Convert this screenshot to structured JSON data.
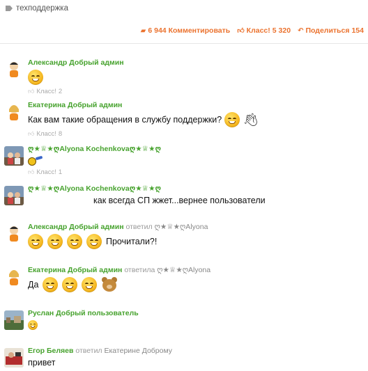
{
  "tag": {
    "label": "техподдержка"
  },
  "actions": {
    "comments": {
      "count": "6 944",
      "label": "Комментировать"
    },
    "klass": {
      "label": "Класс!",
      "count": "5 320"
    },
    "share": {
      "label": "Поделиться",
      "count": "154"
    }
  },
  "comments": [
    {
      "author": "Александр Добрый админ",
      "text": "",
      "like_label": "Класс!",
      "like_count": "2"
    },
    {
      "author": "Екатерина Добрый админ",
      "text": "Как вам такие обращения в службу поддержки?",
      "like_label": "Класс!",
      "like_count": "8"
    },
    {
      "author": "ღ★♕★ღAlyona Kochenkovaღ★♕★ღ",
      "text": "",
      "like_label": "Класс!",
      "like_count": "1"
    },
    {
      "author": "ღ★♕★ღAlyona Kochenkovaღ★♕★ღ",
      "text": "как всегда СП жжет...вернее пользователи"
    },
    {
      "author": "Александр Добрый админ",
      "reply_label": "ответил",
      "reply_to": "ღ★♕★ღAlyona",
      "text": "Прочитали?!"
    },
    {
      "author": "Екатерина Добрый админ",
      "reply_label": "ответила",
      "reply_to": "ღ★♕★ღAlyona",
      "text": "Да"
    },
    {
      "author": "Руслан Добрый пользователь",
      "text": ""
    },
    {
      "author": "Егор Беляев",
      "reply_label": "ответил",
      "reply_to": "Екатерине Доброму",
      "text": "привет"
    }
  ],
  "colors": {
    "accent": "#eb722e",
    "author": "#46a22d"
  }
}
